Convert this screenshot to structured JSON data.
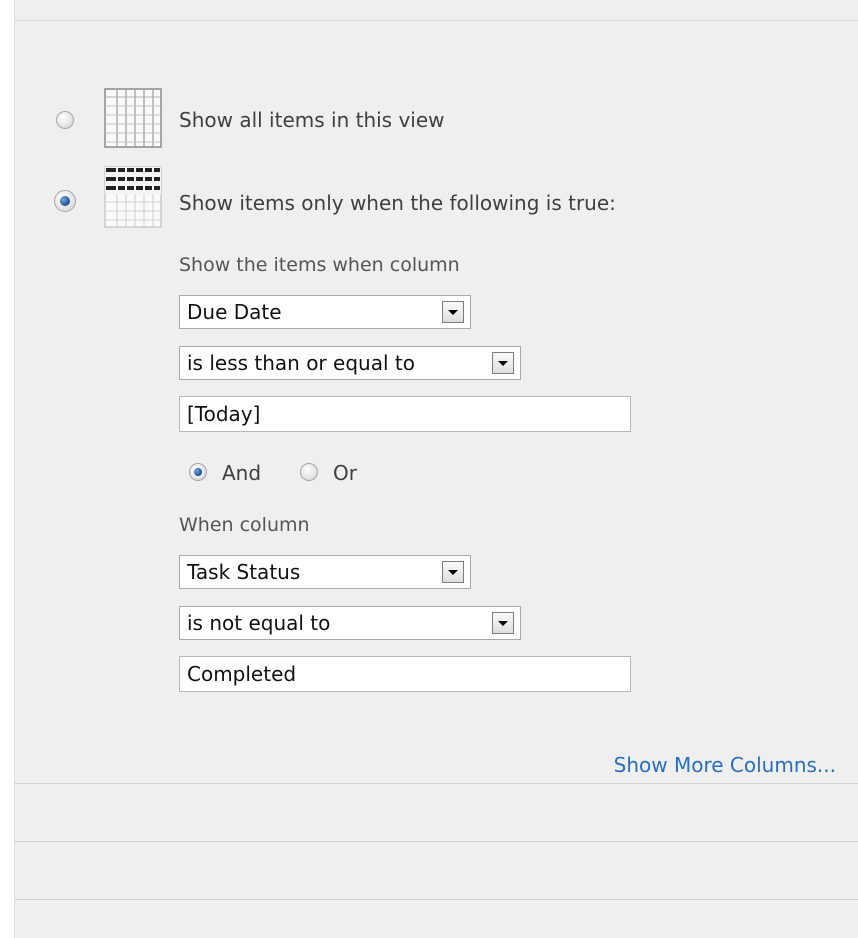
{
  "filter": {
    "show_all_label": "Show all items in this view",
    "show_filtered_label": "Show items only when the following is true:",
    "show_all_selected": false,
    "show_filtered_selected": true,
    "condition1": {
      "caption": "Show the items when column",
      "column_value": "Due Date",
      "operator_value": "is less than or equal to",
      "filter_value": "[Today]"
    },
    "connector": {
      "and_label": "And",
      "or_label": "Or",
      "selected": "And"
    },
    "condition2": {
      "caption": "When column",
      "column_value": "Task Status",
      "operator_value": "is not equal to",
      "filter_value": "Completed"
    },
    "more_columns_link": "Show More Columns..."
  },
  "icons": {
    "show_all": "table-grid-icon",
    "show_filtered": "filtered-table-icon",
    "dropdown": "chevron-down-icon"
  },
  "colors": {
    "panel_background": "#efefef",
    "link": "#2a6ebb",
    "radio_selected": "#1f4f96"
  }
}
